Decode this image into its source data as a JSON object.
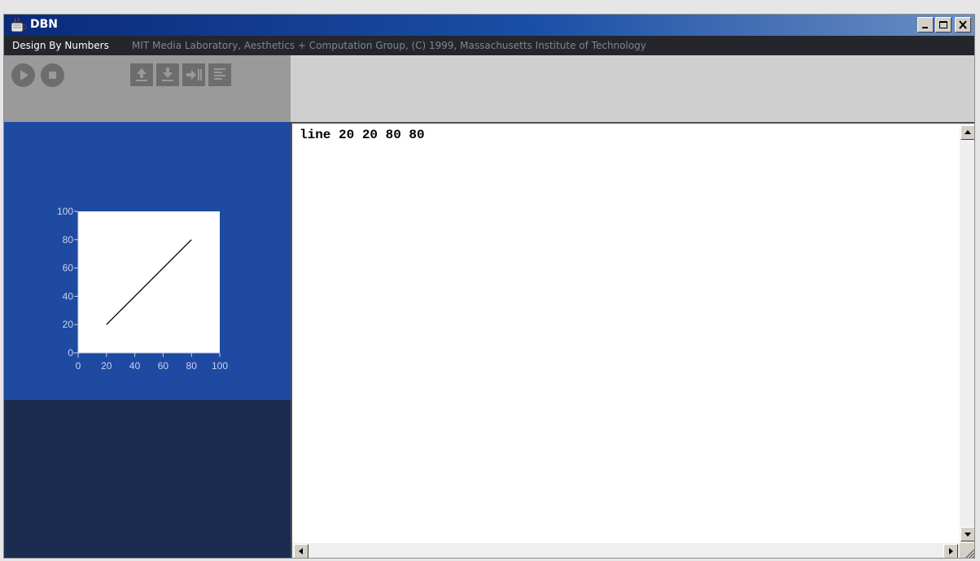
{
  "window": {
    "title": "DBN",
    "controls": [
      "minimize-icon",
      "maximize-icon",
      "close-icon"
    ]
  },
  "menubar": {
    "app_name": "Design By Numbers",
    "credit": "MIT Media Laboratory, Aesthetics + Computation Group, (C) 1999, Massachusetts Institute of Technology"
  },
  "toolbar": {
    "buttons": [
      "run-icon",
      "stop-icon",
      "open-icon",
      "save-icon",
      "export-icon",
      "print-icon"
    ]
  },
  "chart_data": {
    "type": "line",
    "series": [
      {
        "x": [
          20,
          80
        ],
        "y": [
          20,
          80
        ]
      }
    ],
    "xlim": [
      0,
      100
    ],
    "ylim": [
      0,
      100
    ],
    "x_ticks": [
      "0",
      "20",
      "40",
      "60",
      "80",
      "100"
    ],
    "y_ticks": [
      "0",
      "20",
      "40",
      "60",
      "80",
      "100"
    ],
    "grid": false,
    "colors": {
      "panel": "#1e4aa2",
      "canvas": "#ffffff",
      "line": "#000000",
      "tick_labels": "#c9d4ea"
    }
  },
  "editor": {
    "code": "line 20 20 80 80"
  }
}
